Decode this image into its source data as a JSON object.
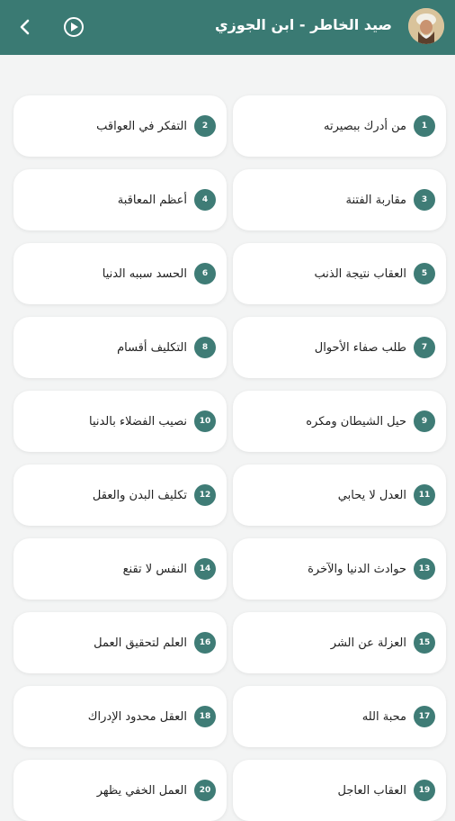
{
  "header": {
    "title": "صيد الخاطر - ابن الجوزي",
    "back_icon": "chevron-left-icon",
    "play_icon": "play-circle-icon",
    "accent_color": "#3a7a73"
  },
  "chapters": [
    {
      "num": "1",
      "title": "من أدرك ببصيرته"
    },
    {
      "num": "2",
      "title": "التفكر في العواقب"
    },
    {
      "num": "3",
      "title": "مقاربة الفتنة"
    },
    {
      "num": "4",
      "title": "أعظم المعاقبة"
    },
    {
      "num": "5",
      "title": "العقاب نتيجة الذنب"
    },
    {
      "num": "6",
      "title": "الحسد سببه الدنيا"
    },
    {
      "num": "7",
      "title": "طلب صفاء الأحوال"
    },
    {
      "num": "8",
      "title": "التكليف أقسام"
    },
    {
      "num": "9",
      "title": "حيل الشيطان ومكره"
    },
    {
      "num": "10",
      "title": "نصيب الفضلاء بالدنيا"
    },
    {
      "num": "11",
      "title": "العدل لا يحابي"
    },
    {
      "num": "12",
      "title": "تكليف البدن والعقل"
    },
    {
      "num": "13",
      "title": "حوادث الدنيا والآخرة"
    },
    {
      "num": "14",
      "title": "النفس لا تقنع"
    },
    {
      "num": "15",
      "title": "العزلة عن الشر"
    },
    {
      "num": "16",
      "title": "العلم لتحقيق العمل"
    },
    {
      "num": "17",
      "title": "محبة الله"
    },
    {
      "num": "18",
      "title": "العقل محدود الإدراك"
    },
    {
      "num": "19",
      "title": "العقاب العاجل"
    },
    {
      "num": "20",
      "title": "العمل الخفي يظهر"
    }
  ]
}
